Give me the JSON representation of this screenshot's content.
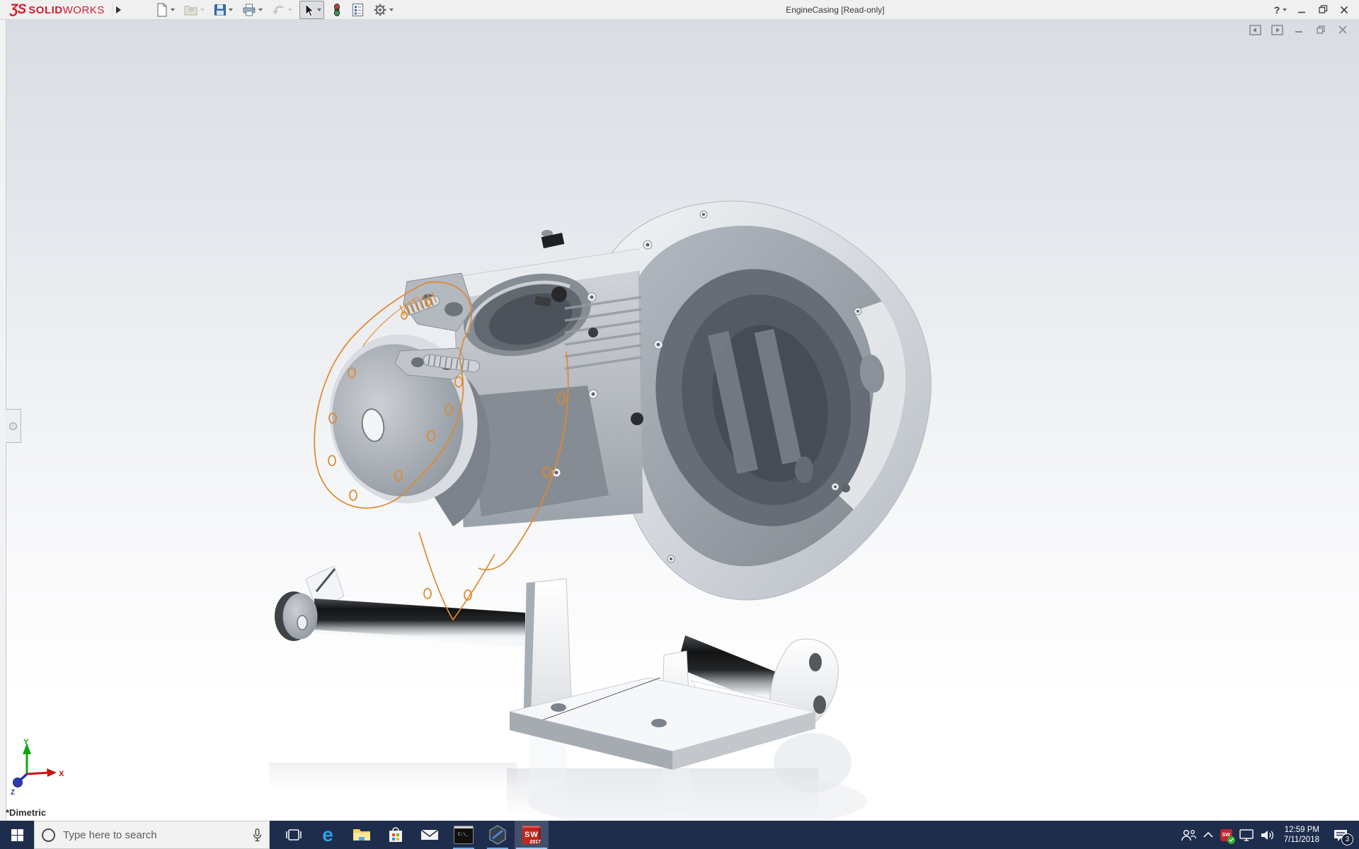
{
  "app": {
    "logo_mark": "ƷS",
    "logo_solid": "SOLID",
    "logo_works": "WORKS"
  },
  "titlebar": {
    "title": "EngineCasing [Read-only]",
    "help_label": "?",
    "window_controls": [
      "minimize",
      "restore",
      "close"
    ]
  },
  "toolbar": {
    "icons": [
      "new-document",
      "open",
      "save",
      "print",
      "undo",
      "select-cursor",
      "rebuild-traffic-light",
      "file-properties",
      "options-gear"
    ],
    "selected_tool": "select-cursor",
    "disabled_tools": [
      "open",
      "undo"
    ]
  },
  "doc_window": {
    "controls": [
      "show-left-pane",
      "show-right-pane",
      "minimize",
      "restore",
      "close"
    ]
  },
  "viewport": {
    "view_orientation_label": "*Dimetric",
    "triad": {
      "x_label": "X",
      "y_label": "Y",
      "z_label": "Z"
    }
  },
  "taskbar": {
    "search": {
      "placeholder": "Type here to search"
    },
    "apps": {
      "task_view": {},
      "edge": {
        "glyph": "e"
      },
      "file_explorer": {},
      "store": {},
      "mail": {},
      "cmd": {
        "glyph": "C:\\_",
        "running": true
      },
      "hex_app": {
        "running": true
      },
      "solidworks": {
        "letters": "SW",
        "year": "2017",
        "active": true
      }
    },
    "tray": {
      "sw_badge": "SW",
      "clock": {
        "time": "12:59 PM",
        "date": "7/11/2018"
      },
      "notification_count": "3"
    }
  },
  "colors": {
    "taskbar_bg": "#1f2d4d",
    "run_indicator": "#76aee0",
    "selection_orange": "#e0882a",
    "logo_red": "#cf1f2f"
  }
}
